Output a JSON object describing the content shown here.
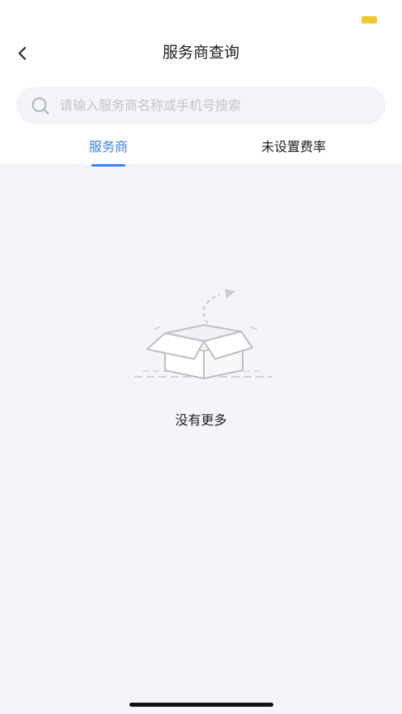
{
  "nav": {
    "title": "服务商查询"
  },
  "search": {
    "placeholder": "请输入服务商名称或手机号搜索"
  },
  "tabs": [
    {
      "label": "服务商",
      "active": true
    },
    {
      "label": "未设置费率",
      "active": false
    }
  ],
  "empty": {
    "text": "没有更多"
  },
  "icons": {
    "back": "chevron-left-icon",
    "search": "search-icon",
    "empty": "empty-box-icon",
    "battery": "battery-icon"
  },
  "colors": {
    "accent": "#3b82f0",
    "battery": "#f5c829",
    "page_background": "#f4f5f9",
    "search_background": "#f3f4f8"
  }
}
